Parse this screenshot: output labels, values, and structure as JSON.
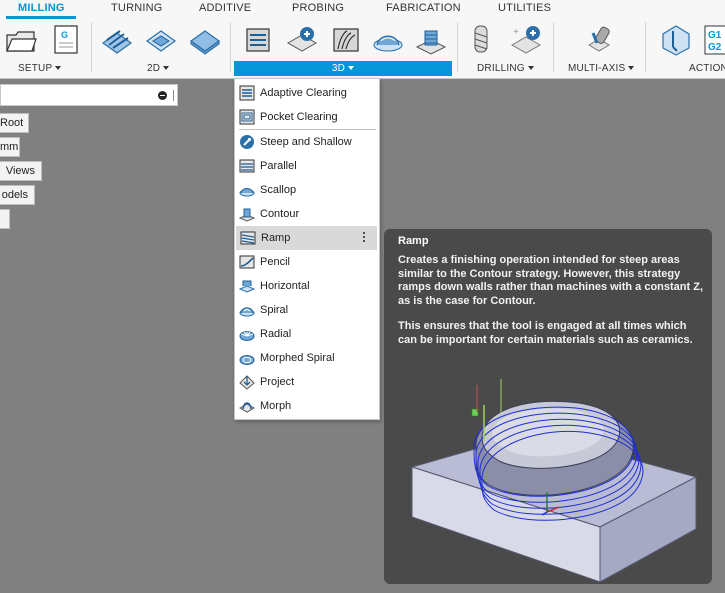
{
  "toolbar": {
    "tabs": [
      "MILLING",
      "TURNING",
      "ADDITIVE",
      "PROBING",
      "FABRICATION",
      "UTILITIES"
    ],
    "active_tab": "MILLING",
    "groups": {
      "setup": "SETUP",
      "g2d": "2D",
      "g3d": "3D",
      "drilling": "DRILLING",
      "multiaxis": "MULTI-AXIS",
      "actions": "ACTION"
    },
    "nc_program_icon_text": "G",
    "gcode_icon_text": "G1\nG2",
    "accent_color": "#0696d7"
  },
  "browser": {
    "nodes": [
      "Root",
      "mm",
      "Views",
      "odels",
      ""
    ]
  },
  "dropdown": {
    "items": [
      {
        "label": "Adaptive Clearing",
        "icon": "adaptive-clearing-icon"
      },
      {
        "label": "Pocket Clearing",
        "icon": "pocket-clearing-icon"
      },
      {
        "label": "Steep and Shallow",
        "icon": "steep-and-shallow-icon"
      },
      {
        "label": "Parallel",
        "icon": "parallel-icon"
      },
      {
        "label": "Scallop",
        "icon": "scallop-icon"
      },
      {
        "label": "Contour",
        "icon": "contour-icon"
      },
      {
        "label": "Ramp",
        "icon": "ramp-icon",
        "highlighted": true
      },
      {
        "label": "Pencil",
        "icon": "pencil-icon"
      },
      {
        "label": "Horizontal",
        "icon": "horizontal-icon"
      },
      {
        "label": "Spiral",
        "icon": "spiral-icon"
      },
      {
        "label": "Radial",
        "icon": "radial-icon"
      },
      {
        "label": "Morphed Spiral",
        "icon": "morphed-spiral-icon"
      },
      {
        "label": "Project",
        "icon": "project-icon"
      },
      {
        "label": "Morph",
        "icon": "morph-icon"
      }
    ]
  },
  "tooltip": {
    "title": "Ramp",
    "para1": "Creates a finishing operation intended for steep areas similar to the Contour strategy. However, this strategy ramps down walls rather than machines with a constant Z, as is the case for Contour.",
    "para2": "This ensures that the tool is engaged at all times which can be important for certain materials such as ceramics."
  }
}
